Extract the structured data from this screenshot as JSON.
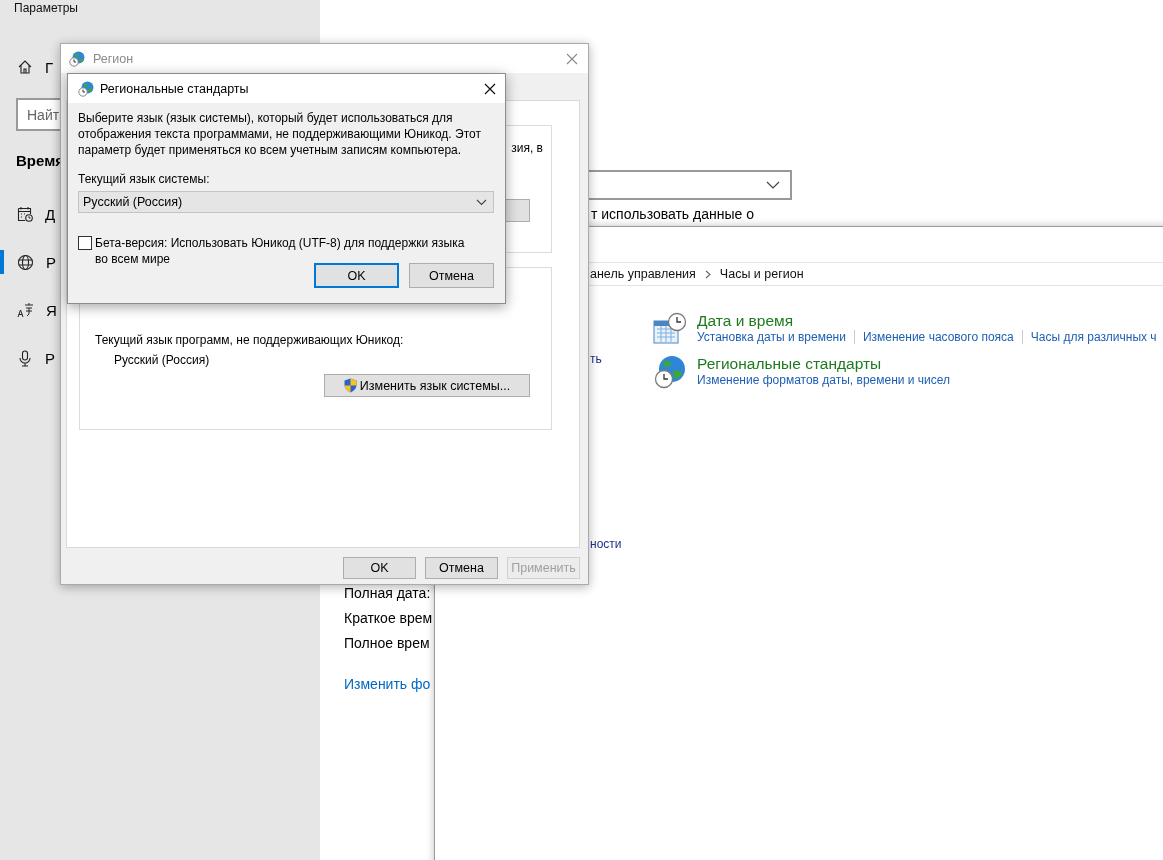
{
  "settings_window": {
    "title": "Параметры",
    "sidebar": {
      "home_item": "Г",
      "search": {
        "placeholder": "Найт"
      },
      "section_heading": "Время",
      "items": [
        {
          "label": "Д",
          "kind": "calendar",
          "selected": false
        },
        {
          "label": "Р",
          "kind": "globe",
          "selected": true
        },
        {
          "label": "Я",
          "kind": "language",
          "selected": false
        },
        {
          "label": "Р",
          "kind": "microphone",
          "selected": false
        }
      ]
    },
    "content": {
      "text_fragment": "т использовать данные о",
      "format_labels": [
        "Полная дата:",
        "Краткое врем",
        "Полное врем"
      ],
      "link": "Изменить фо"
    }
  },
  "control_panel": {
    "breadcrumb": [
      "анель управления",
      "Часы и регион"
    ],
    "side_fragments": [
      "ть",
      "ности"
    ],
    "categories": [
      {
        "kind": "datetime",
        "title": "Дата и время",
        "links": [
          "Установка даты и времени",
          "Изменение часового пояса",
          "Часы для различных ч"
        ]
      },
      {
        "kind": "region",
        "title": "Региональные стандарты",
        "links": [
          "Изменение форматов даты, времени и чисел"
        ]
      }
    ]
  },
  "region_dialog": {
    "title": "Регион",
    "active": false,
    "group_1": {
      "text_fragment": "зия, в"
    },
    "group_2": {
      "label": "Текущий язык программ, не поддерживающих Юникод:",
      "value": "Русский (Россия)",
      "button": "Изменить язык системы..."
    },
    "buttons": [
      {
        "label": "OK",
        "disabled": false
      },
      {
        "label": "Отмена",
        "disabled": false
      },
      {
        "label": "Применить",
        "disabled": true
      }
    ]
  },
  "regional_dialog": {
    "title": "Региональные стандарты",
    "description": "Выберите язык (язык системы), который будет использоваться для отображения текста программами, не поддерживающими Юникод. Этот параметр будет применяться ко всем учетным записям компьютера.",
    "select_label": "Текущий язык системы:",
    "select": {
      "value": "Русский (Россия)"
    },
    "checkbox": {
      "label": "Бета-версия: Использовать Юникод (UTF-8) для поддержки языка во всем мире",
      "checked": false
    },
    "buttons": [
      {
        "label": "OK",
        "default": true
      },
      {
        "label": "Отмена",
        "default": false
      }
    ]
  }
}
